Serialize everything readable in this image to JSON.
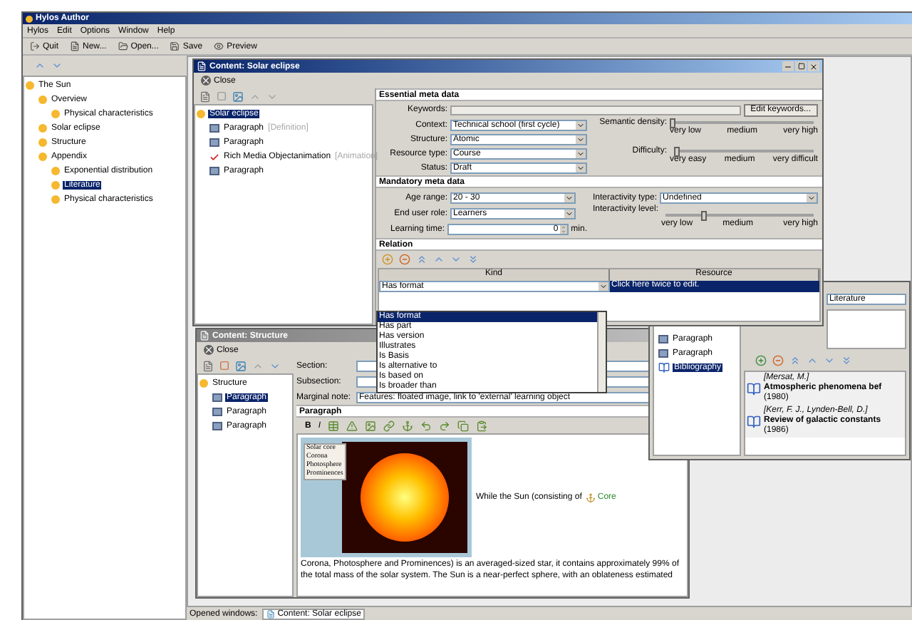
{
  "app": {
    "title": "Hylos Author"
  },
  "menu": [
    "Hylos",
    "Edit",
    "Options",
    "Window",
    "Help"
  ],
  "toolbar": [
    {
      "label": "Quit",
      "kind": "quit"
    },
    {
      "label": "New...",
      "kind": "new"
    },
    {
      "label": "Open...",
      "kind": "open"
    },
    {
      "label": "Save",
      "kind": "save"
    },
    {
      "label": "Preview",
      "kind": "preview"
    }
  ],
  "outline": [
    {
      "label": "The Sun",
      "kind": "topic",
      "selected": false,
      "children": [
        {
          "label": "Overview",
          "kind": "topic",
          "selected": false,
          "children": [
            {
              "label": "Physical characteristics",
              "kind": "topic",
              "selected": false
            }
          ]
        },
        {
          "label": "Solar eclipse",
          "kind": "topic",
          "selected": false
        },
        {
          "label": "Structure",
          "kind": "topic",
          "selected": false
        },
        {
          "label": "Appendix",
          "kind": "topic",
          "selected": false,
          "children": [
            {
              "label": "Exponential distribution",
              "kind": "topic",
              "selected": false
            },
            {
              "label": "Literature",
              "kind": "topic",
              "selected": true
            },
            {
              "label": "Physical characteristics",
              "kind": "topic",
              "selected": false
            }
          ]
        }
      ]
    }
  ],
  "solar_window": {
    "title": "Content: Solar eclipse",
    "close": "Close",
    "tree": [
      {
        "label": "Solar eclipse",
        "kind": "topic",
        "selected": true,
        "children": [
          {
            "label": "Paragraph",
            "note": "[Definition]",
            "kind": "paragraph",
            "selected": false
          },
          {
            "label": "Paragraph",
            "kind": "paragraph",
            "selected": false
          },
          {
            "label": "Rich Media Objectanimation",
            "note": "[Animation]",
            "kind": "media",
            "selected": false
          },
          {
            "label": "Paragraph",
            "kind": "paragraph",
            "selected": false
          }
        ]
      }
    ],
    "essential": {
      "header": "Essential meta data",
      "keywords_label": "Keywords:",
      "edit_keywords": "Edit keywords...",
      "fields": [
        {
          "label": "Context:",
          "value": "Technical school (first cycle)"
        },
        {
          "label": "Structure:",
          "value": "Atomic"
        },
        {
          "label": "Resource type:",
          "value": "Course"
        },
        {
          "label": "Status:",
          "value": "Draft"
        }
      ],
      "sliders": [
        {
          "label": "Semantic density:",
          "level": 0.0,
          "ticks": [
            "very low",
            "medium",
            "very high"
          ]
        },
        {
          "label": "Difficulty:",
          "level": 0.03,
          "ticks": [
            "very easy",
            "medium",
            "very difficult"
          ]
        }
      ]
    },
    "mandatory": {
      "header": "Mandatory meta data",
      "fields": [
        {
          "label": "Age range:",
          "value": "20 - 30",
          "kind": "select"
        },
        {
          "label": "End user role:",
          "value": "Learners",
          "kind": "select"
        },
        {
          "label": "Learning time:",
          "value": "0",
          "unit": "min.",
          "kind": "spin"
        }
      ],
      "interactivity_type": {
        "label": "Interactivity type:",
        "value": "Undefined"
      },
      "interactivity_level": {
        "label": "Interactivity level:",
        "level": 0.26,
        "ticks": [
          "very low",
          "medium",
          "very high"
        ]
      }
    },
    "relation": {
      "header": "Relation",
      "columns": [
        "Kind",
        "Resource"
      ],
      "row": {
        "kind": "Has format",
        "resource": "Click here twice to edit.",
        "selected": true
      },
      "options": [
        {
          "label": "Has format",
          "selected": true
        },
        {
          "label": "Has part",
          "selected": false
        },
        {
          "label": "Has version",
          "selected": false
        },
        {
          "label": "Illustrates",
          "selected": false
        },
        {
          "label": "Is Basis",
          "selected": false
        },
        {
          "label": "Is alternative to",
          "selected": false
        },
        {
          "label": "Is based on",
          "selected": false
        },
        {
          "label": "Is broader than",
          "selected": false
        }
      ]
    }
  },
  "structure_window": {
    "title": "Content: Structure",
    "close": "Close",
    "tree": [
      {
        "label": "Structure",
        "kind": "topic",
        "selected": false,
        "children": [
          {
            "label": "Paragraph",
            "kind": "paragraph",
            "selected": true
          },
          {
            "label": "Paragraph",
            "kind": "paragraph",
            "selected": false
          },
          {
            "label": "Paragraph",
            "kind": "paragraph",
            "selected": false
          }
        ]
      }
    ],
    "fields": [
      {
        "label": "Section:"
      },
      {
        "label": "Subsection:"
      },
      {
        "label": "Marginal note:",
        "value": "Features: floated image, link to 'external' learning object"
      }
    ],
    "paragraph": {
      "header": "Paragraph",
      "bold": "B",
      "italic": "I",
      "figure_labels": [
        "Solar core",
        "Corona",
        "Photosphere",
        "Prominences"
      ],
      "text_before": "While the Sun (consisting of",
      "link": "Core",
      "text_after": "Corona, Photosphere and Prominences) is an averaged-sized star, it contains approximately 99% of the total mass of the solar system. The Sun is a near-perfect sphere, with an oblateness estimated"
    }
  },
  "literature_window": {
    "tree": [
      {
        "label": "Paragraph",
        "kind": "paragraph",
        "selected": false
      },
      {
        "label": "Paragraph",
        "kind": "paragraph",
        "selected": false
      },
      {
        "label": "Bibliography",
        "kind": "bibliography",
        "selected": true
      }
    ],
    "field": "Literature",
    "entries": [
      {
        "author": "[Mersat, M.]",
        "title": "Atmospheric phenomena bef",
        "year": "(1980)"
      },
      {
        "author": "[Kerr, F. J., Lynden-Bell, D.]",
        "title": "Review of galactic constants",
        "year": "(1986)"
      }
    ]
  },
  "status_bar": {
    "label": "Opened windows:",
    "tabs": [
      "Content: Solar eclipse"
    ]
  }
}
